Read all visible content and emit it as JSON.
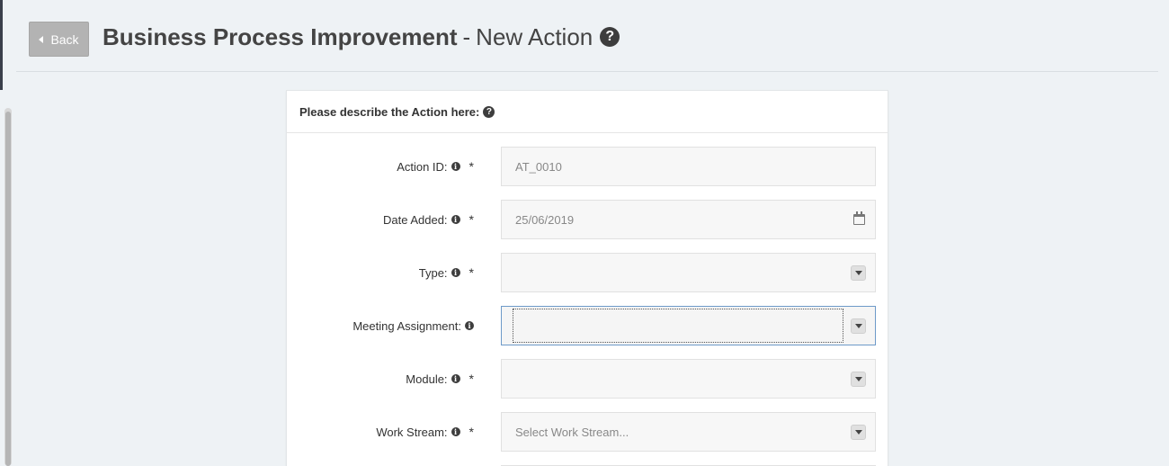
{
  "header": {
    "back_label": "Back",
    "title_bold": "Business Process Improvement",
    "title_sep": "-",
    "title_rest": "New Action",
    "help_glyph": "?"
  },
  "panel": {
    "heading": "Please describe the Action here:",
    "help_glyph": "?"
  },
  "form": {
    "action_id": {
      "label": "Action ID:",
      "value": "AT_0010",
      "required": "*"
    },
    "date_added": {
      "label": "Date Added:",
      "value": "25/06/2019",
      "required": "*"
    },
    "type": {
      "label": "Type:",
      "value": "",
      "required": "*"
    },
    "meeting_assignment": {
      "label": "Meeting Assignment:",
      "value": ""
    },
    "module": {
      "label": "Module:",
      "value": "",
      "required": "*"
    },
    "work_stream": {
      "label": "Work Stream:",
      "placeholder": "Select Work Stream...",
      "required": "*"
    }
  },
  "icons": {
    "info": "i",
    "calendar": "calendar-icon",
    "dropdown": "caret-down-icon"
  },
  "colors": {
    "page_bg": "#eef2f5",
    "back_button_bg": "#b3b3b3",
    "focus_border": "#6e9ac9"
  }
}
